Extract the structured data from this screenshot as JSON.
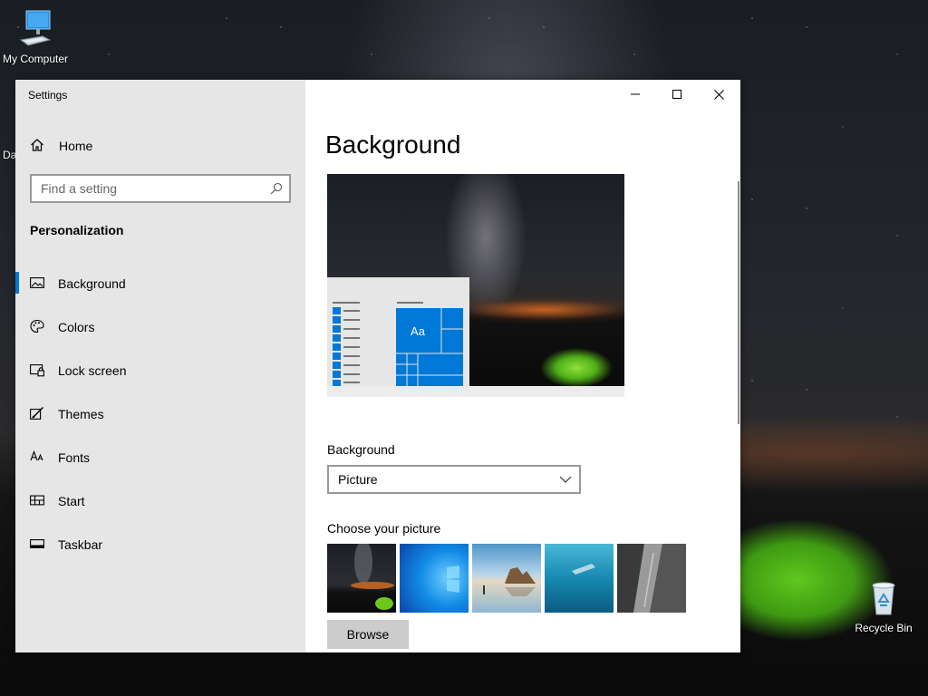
{
  "desktop": {
    "icons": [
      {
        "label": "My Computer"
      },
      {
        "label": "Recycle Bin"
      }
    ],
    "partial_label": "Da"
  },
  "window": {
    "title": "Settings",
    "controls": {
      "minimize": "minimize-icon",
      "maximize": "maximize-icon",
      "close": "close-icon"
    }
  },
  "sidebar": {
    "home_label": "Home",
    "search": {
      "placeholder": "Find a setting",
      "value": ""
    },
    "section_title": "Personalization",
    "items": [
      {
        "label": "Background",
        "icon": "picture-icon",
        "active": true
      },
      {
        "label": "Colors",
        "icon": "palette-icon",
        "active": false
      },
      {
        "label": "Lock screen",
        "icon": "lock-screen-icon",
        "active": false
      },
      {
        "label": "Themes",
        "icon": "themes-icon",
        "active": false
      },
      {
        "label": "Fonts",
        "icon": "fonts-icon",
        "active": false
      },
      {
        "label": "Start",
        "icon": "start-icon",
        "active": false
      },
      {
        "label": "Taskbar",
        "icon": "taskbar-icon",
        "active": false
      }
    ]
  },
  "content": {
    "page_title": "Background",
    "preview": {
      "tile_label": "Aa"
    },
    "background_label": "Background",
    "background_select": {
      "value": "Picture"
    },
    "choose_label": "Choose your picture",
    "thumbnails": [
      "Milky way tent",
      "Windows light",
      "Beach rocks",
      "Underwater swimmer",
      "Rock cliff"
    ],
    "browse_label": "Browse"
  },
  "colors": {
    "accent": "#0078d7",
    "sidebar_bg": "#e6e6e6",
    "browse_bg": "#cccccc"
  }
}
